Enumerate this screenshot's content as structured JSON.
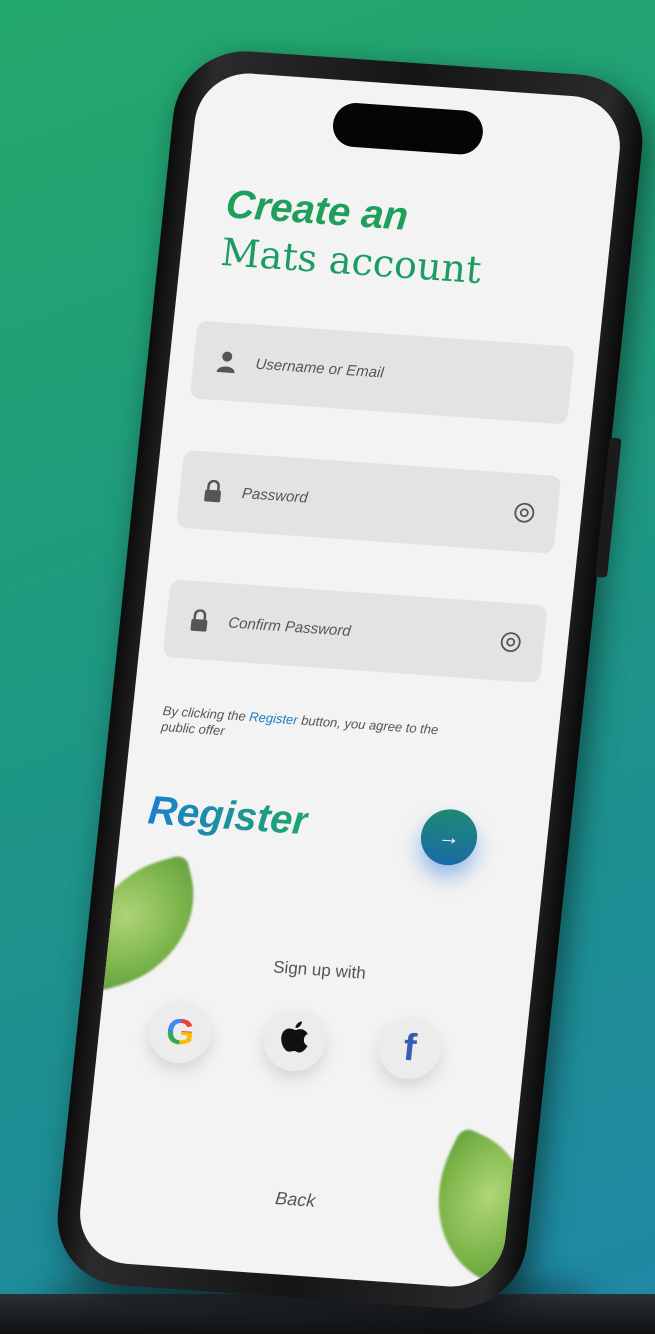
{
  "title": {
    "line1": "Create an",
    "line2": "Mats account"
  },
  "fields": {
    "username_placeholder": "Username or Email",
    "password_placeholder": "Password",
    "confirm_placeholder": "Confirm Password"
  },
  "terms": {
    "prefix": "By clicking the ",
    "link": "Register",
    "suffix": " button, you agree to the public offer"
  },
  "register": {
    "label": "Register",
    "arrow": "→"
  },
  "signup": {
    "label": "Sign up with",
    "google_glyph": "G",
    "apple_icon": "apple-icon",
    "facebook_glyph": "f"
  },
  "back_label": "Back",
  "colors": {
    "accent_green": "#1f9e5c",
    "link_blue": "#1a7cc0",
    "button_start": "#1e8a74",
    "button_end": "#1a6aa5"
  }
}
